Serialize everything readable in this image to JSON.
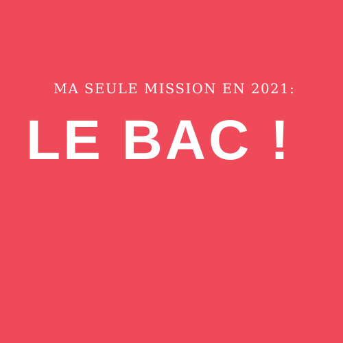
{
  "poster": {
    "subtitle": "MA SEULE MISSION EN 2021:",
    "headline": "LE BAC !"
  },
  "colors": {
    "background": "#ef4a5a",
    "text": "#ffffff"
  }
}
